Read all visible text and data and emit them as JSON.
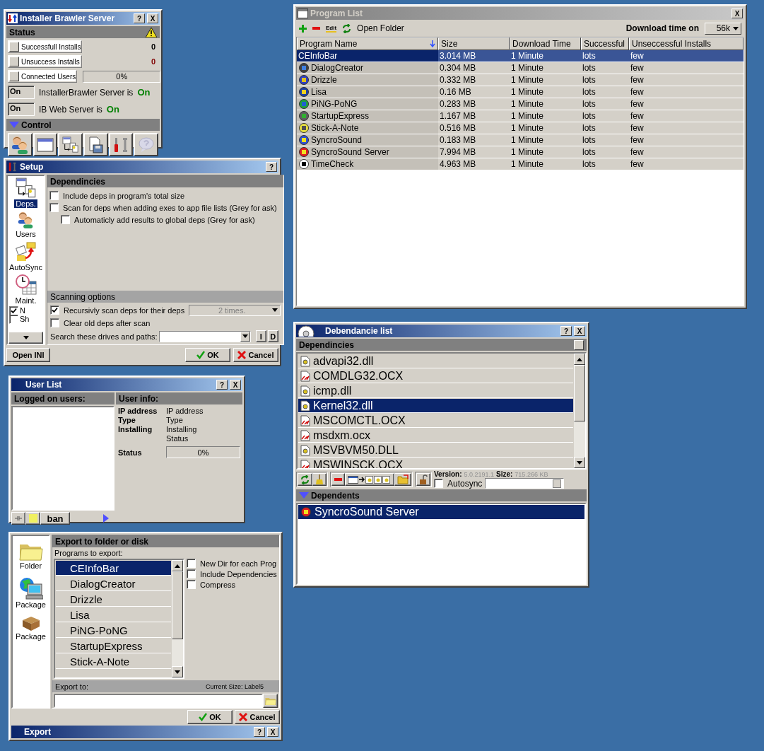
{
  "server_window": {
    "title": "Installer Brawler Server",
    "title_buttons": [
      "?",
      "X"
    ],
    "status_header": "Status",
    "counters": [
      {
        "kind": "count",
        "label": "Successfull Installs",
        "value": "0"
      },
      {
        "kind": "error",
        "label": "Unsuccess Installs",
        "value": "0"
      },
      {
        "kind": "progress",
        "label": "Connected Users",
        "reading": "0%",
        "level": 0
      }
    ],
    "services": [
      {
        "toggle": "On",
        "label": "InstallerBrawler Server is",
        "state": "On",
        "on": true
      },
      {
        "toggle": "On",
        "label": "IB Web Server is",
        "state": "On",
        "on": true
      }
    ],
    "control_header": "Control"
  },
  "setup_window": {
    "title": "Setup",
    "title_buttons": [
      "?"
    ],
    "nav": [
      {
        "kind": "deps",
        "label": "Deps.",
        "selected": true
      },
      {
        "kind": "users",
        "label": "Users",
        "selected": false
      },
      {
        "kind": "sync",
        "label": "AutoSync",
        "selected": false
      },
      {
        "kind": "maint",
        "label": "Maint.",
        "selected": false
      }
    ],
    "nav_checks": [
      {
        "label": "N",
        "checked": true
      },
      {
        "label": "Sh",
        "checked": false
      }
    ],
    "section_title": "Dependincies",
    "options": [
      {
        "label": "Include deps in program's total size",
        "checked": false
      },
      {
        "label": "Scan for deps when adding exes to app file lists (Grey for ask)",
        "checked": false,
        "children": [
          {
            "label": "Automaticly add results to global deps (Grey for ask)",
            "checked": false
          }
        ]
      }
    ],
    "scanning_title": "Scanning options",
    "scan_options": [
      {
        "label": "Recursivly scan deps for their deps",
        "checked": true,
        "dropdown": "2 times."
      },
      {
        "label": "Clear old deps after scan",
        "checked": false
      }
    ],
    "search_label": "Search these drives and paths:",
    "path_buttons": [
      "I",
      "D"
    ],
    "open_ini": "Open INI",
    "ok": "OK",
    "cancel": "Cancel"
  },
  "user_window": {
    "title": "User List",
    "title_buttons": [
      "?",
      "X"
    ],
    "users_header": "Logged on users:",
    "info_header": "User info:",
    "fields": [
      {
        "label": "IP address",
        "value": "IP address"
      },
      {
        "label": "Type",
        "value": "Type"
      },
      {
        "label": "Installing",
        "value": "Installing"
      },
      {
        "value": "Status"
      }
    ],
    "status_label": "Status",
    "status_reading": "0%",
    "level": 0,
    "ban": "ban"
  },
  "export_window": {
    "title": "Export",
    "title_buttons": [
      "?",
      "X"
    ],
    "nav": [
      {
        "kind": "folder",
        "label": "Folder"
      },
      {
        "kind": "network",
        "label": "Package"
      },
      {
        "kind": "box",
        "label": "Package"
      }
    ],
    "section_title": "Export to folder or disk",
    "programs_label": "Programs to export:",
    "programs": [
      {
        "name": "CEInfoBar",
        "selected": true
      },
      {
        "name": "DialogCreator",
        "selected": false
      },
      {
        "name": "Drizzle",
        "selected": false
      },
      {
        "name": "Lisa",
        "selected": false
      },
      {
        "name": "PiNG-PoNG",
        "selected": false
      },
      {
        "name": "StartupExpress",
        "selected": false
      },
      {
        "name": "Stick-A-Note",
        "selected": false
      }
    ],
    "options": [
      {
        "label": "New Dir for each Prog",
        "checked": false
      },
      {
        "label": "Include Dependencies",
        "checked": false
      },
      {
        "label": "Compress",
        "checked": false
      }
    ],
    "export_to_label": "Export to:",
    "current_size": "Current Size: Label5",
    "ok": "OK",
    "cancel": "Cancel"
  },
  "program_window": {
    "title": "Program List",
    "title_buttons": [
      "X"
    ],
    "edit": "Edit",
    "open_folder": "Open Folder",
    "download_label": "Download time on",
    "speed": "56k",
    "columns": [
      "Program Name",
      "Size",
      "Download Time",
      "Successful",
      "Unseccessful Installs"
    ],
    "rows": [
      {
        "cells": [
          "CEInfoBar",
          "3.014 MB",
          "1 Minute",
          "lots",
          "few"
        ],
        "selected": true
      },
      {
        "cells": [
          "DialogCreator",
          "0.304 MB",
          "1 Minute",
          "lots",
          "few"
        ],
        "selected": false
      },
      {
        "cells": [
          "Drizzle",
          "0.332 MB",
          "1 Minute",
          "lots",
          "few"
        ],
        "selected": false
      },
      {
        "cells": [
          "Lisa",
          "0.16 MB",
          "1 Minute",
          "lots",
          "few"
        ],
        "selected": false
      },
      {
        "cells": [
          "PiNG-PoNG",
          "0.283 MB",
          "1 Minute",
          "lots",
          "few"
        ],
        "selected": false
      },
      {
        "cells": [
          "StartupExpress",
          "1.167 MB",
          "1 Minute",
          "lots",
          "few"
        ],
        "selected": false
      },
      {
        "cells": [
          "Stick-A-Note",
          "0.516 MB",
          "1 Minute",
          "lots",
          "few"
        ],
        "selected": false
      },
      {
        "cells": [
          "SyncroSound",
          "0.183 MB",
          "1 Minute",
          "lots",
          "few"
        ],
        "selected": false
      },
      {
        "cells": [
          "SyncroSound Server",
          "7.994 MB",
          "1 Minute",
          "lots",
          "few"
        ],
        "selected": false
      },
      {
        "cells": [
          "TimeCheck",
          "4.963 MB",
          "1 Minute",
          "lots",
          "few"
        ],
        "selected": false
      }
    ]
  },
  "deps_window": {
    "title": "Debendancie list",
    "title_buttons": [
      "?",
      "X"
    ],
    "deps_header": "Dependincies",
    "deps": [
      {
        "kind": "dll",
        "name": "advapi32.dll",
        "selected": false
      },
      {
        "kind": "ocx",
        "name": "COMDLG32.OCX",
        "selected": false
      },
      {
        "kind": "dll",
        "name": "icmp.dll",
        "selected": false
      },
      {
        "kind": "dll",
        "name": "Kernel32.dll",
        "selected": true
      },
      {
        "kind": "ocx",
        "name": "MSCOMCTL.OCX",
        "selected": false
      },
      {
        "kind": "ocx",
        "name": "msdxm.ocx",
        "selected": false
      },
      {
        "kind": "dll",
        "name": "MSVBVM50.DLL",
        "selected": false
      },
      {
        "kind": "ocx",
        "name": "MSWINSCK.OCX",
        "selected": false
      }
    ],
    "version_label": "Version:",
    "version": "5.0.2191.1",
    "size_label": "Size:",
    "size": "715.266 KB",
    "autosync": {
      "label": "Autosync",
      "checked": false
    },
    "dependents_header": "Dependents",
    "dependents": [
      {
        "name": "SyncroSound Server",
        "selected": true
      }
    ]
  }
}
